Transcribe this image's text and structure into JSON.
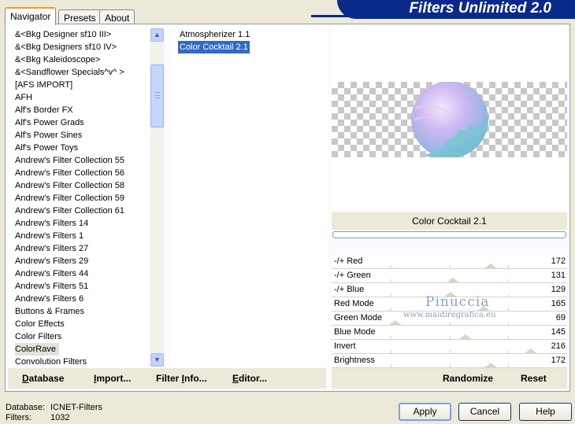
{
  "app": {
    "title": "Filters Unlimited 2.0"
  },
  "tabs": [
    {
      "label": "Navigator",
      "active": true
    },
    {
      "label": "Presets",
      "active": false
    },
    {
      "label": "About",
      "active": false
    }
  ],
  "categories": {
    "items": [
      "&<Bkg Designer sf10 III>",
      "&<Bkg Designers sf10 IV>",
      "&<Bkg Kaleidoscope>",
      "&<Sandflower Specials^v^ >",
      "[AFS IMPORT]",
      "AFH",
      "Alf's Border FX",
      "Alf's Power Grads",
      "Alf's Power Sines",
      "Alf's Power Toys",
      "Andrew's Filter Collection 55",
      "Andrew's Filter Collection 56",
      "Andrew's Filter Collection 58",
      "Andrew's Filter Collection 59",
      "Andrew's Filter Collection 61",
      "Andrew's Filters 14",
      "Andrew's Filters 1",
      "Andrew's Filters 27",
      "Andrew's Filters 29",
      "Andrew's Filters 44",
      "Andrew's Filters 51",
      "Andrew's Filters 6",
      "Buttons & Frames",
      "Color Effects",
      "Color Filters",
      "ColorRave",
      "Convolution Filters"
    ],
    "selected_index": 25
  },
  "filters": {
    "items": [
      "Atmospherizer 1.1",
      "Color Cocktail 2.1"
    ],
    "selected_index": 1
  },
  "preview": {
    "filter_name": "Color Cocktail 2.1",
    "progress": 0
  },
  "sliders": [
    {
      "label": "-/+ Red",
      "value": 172,
      "max": 255
    },
    {
      "label": "-/+ Green",
      "value": 131,
      "max": 255
    },
    {
      "label": "-/+ Blue",
      "value": 129,
      "max": 255
    },
    {
      "label": "Red Mode",
      "value": 165,
      "max": 255
    },
    {
      "label": "Green Mode",
      "value": 69,
      "max": 255
    },
    {
      "label": "Blue Mode",
      "value": 145,
      "max": 255
    },
    {
      "label": "Invert",
      "value": 216,
      "max": 255
    },
    {
      "label": "Brightness",
      "value": 172,
      "max": 255
    }
  ],
  "watermark": {
    "line1": "Pinuccia",
    "line2": "www.maidiregrafica.eu"
  },
  "toolbar": {
    "database": {
      "pre": "",
      "ul": "D",
      "post": "atabase"
    },
    "import": {
      "pre": "",
      "ul": "I",
      "post": "mport..."
    },
    "filter_info": {
      "pre": "Filter ",
      "ul": "I",
      "post": "nfo..."
    },
    "editor": {
      "pre": "",
      "ul": "E",
      "post": "ditor..."
    },
    "randomize": "Randomize",
    "reset": "Reset"
  },
  "status": {
    "database_label": "Database:",
    "database_value": "ICNET-Filters",
    "filters_label": "Filters:",
    "filters_value": "1032"
  },
  "buttons": {
    "apply": "Apply",
    "cancel": "Cancel",
    "help": "Help"
  },
  "colors": {
    "selection": "#316ac5",
    "banner": "#0a2a8a",
    "tab_accent": "#e5a029"
  }
}
